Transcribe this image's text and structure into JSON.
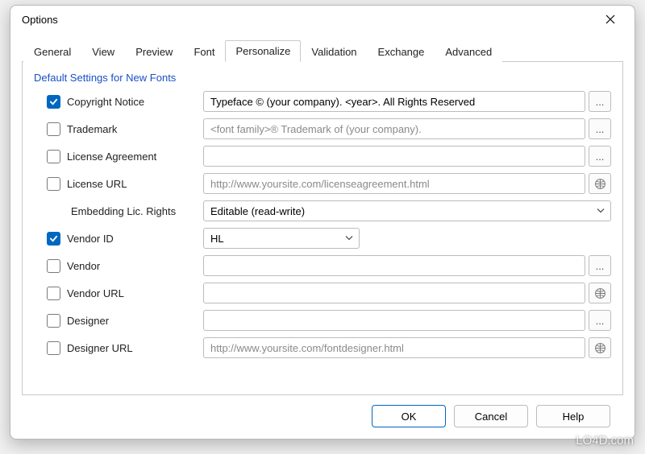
{
  "window": {
    "title": "Options"
  },
  "tabs": {
    "items": [
      {
        "label": "General"
      },
      {
        "label": "View"
      },
      {
        "label": "Preview"
      },
      {
        "label": "Font"
      },
      {
        "label": "Personalize"
      },
      {
        "label": "Validation"
      },
      {
        "label": "Exchange"
      },
      {
        "label": "Advanced"
      }
    ],
    "active_index": 4
  },
  "group": {
    "title": "Default Settings for New Fonts"
  },
  "fields": {
    "copyright": {
      "label": "Copyright Notice",
      "checked": true,
      "value": "Typeface © (your company). <year>. All Rights Reserved",
      "btn": "ellipsis"
    },
    "trademark": {
      "label": "Trademark",
      "checked": false,
      "value": "<font family>® Trademark of (your company).",
      "btn": "ellipsis",
      "ghost": true
    },
    "license": {
      "label": "License Agreement",
      "checked": false,
      "value": "",
      "btn": "ellipsis"
    },
    "licenseurl": {
      "label": "License URL",
      "checked": false,
      "value": "http://www.yoursite.com/licenseagreement.html",
      "btn": "globe",
      "ghost": true
    },
    "embedding": {
      "label": "Embedding Lic. Rights",
      "value": "Editable (read-write)"
    },
    "vendorid": {
      "label": "Vendor ID",
      "checked": true,
      "value": "HL"
    },
    "vendor": {
      "label": "Vendor",
      "checked": false,
      "value": "",
      "btn": "ellipsis"
    },
    "vendorurl": {
      "label": "Vendor URL",
      "checked": false,
      "value": "",
      "btn": "globe"
    },
    "designer": {
      "label": "Designer",
      "checked": false,
      "value": "",
      "btn": "ellipsis"
    },
    "designerurl": {
      "label": "Designer URL",
      "checked": false,
      "value": "http://www.yoursite.com/fontdesigner.html",
      "btn": "globe",
      "ghost": true
    }
  },
  "buttons": {
    "ok": "OK",
    "cancel": "Cancel",
    "help": "Help"
  },
  "watermark": "LO4D.com"
}
